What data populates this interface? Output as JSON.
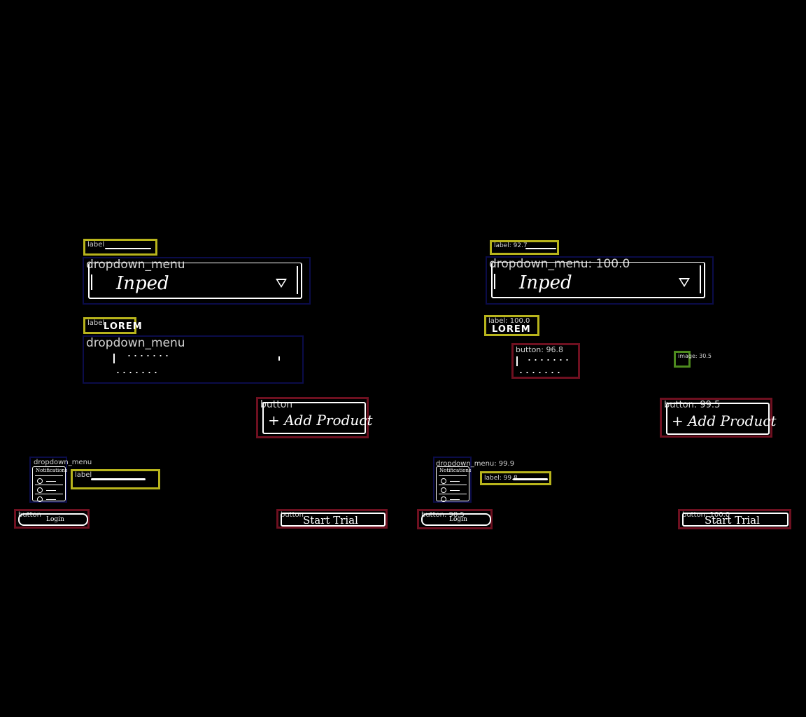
{
  "left": {
    "label_top": "label",
    "dropdown_top": "dropdown_menu",
    "dropdown_top_value": "Inped",
    "label_lorem": "label",
    "lorem_text": "LOREM",
    "dropdown_mid": "dropdown_menu",
    "button_add": "button",
    "add_product": "+ Add Product",
    "dropdown_notif": "dropdown_menu",
    "notif_title": "Notifications",
    "label_small": "label",
    "button_login": "button",
    "login_text": "Login",
    "button_trial": "button",
    "trial_text": "Start Trial"
  },
  "right": {
    "label_top": "label: 92.7",
    "dropdown_top": "dropdown_menu: 100.0",
    "dropdown_top_value": "Inped",
    "label_lorem": "label: 100.0",
    "lorem_text": "LOREM",
    "button_mid": "button: 96.8",
    "image_small": "image: 30.5",
    "button_add": "button: 99.5",
    "add_product": "+ Add Product",
    "dropdown_notif": "dropdown_menu: 99.9",
    "notif_title": "Notifications",
    "label_small": "label: 99.8",
    "button_login": "button: 98.5",
    "login_text": "Login",
    "button_trial": "button: 100.0",
    "trial_text": "Start Trial"
  },
  "colors": {
    "background": "#000000",
    "label_box": "#b8b41c",
    "dropdown_box": "#0b0c4a",
    "button_box": "#6e1020",
    "image_box": "#4d8a1e",
    "tag_text": "#d2d2d2",
    "sketch": "#ffffff"
  }
}
